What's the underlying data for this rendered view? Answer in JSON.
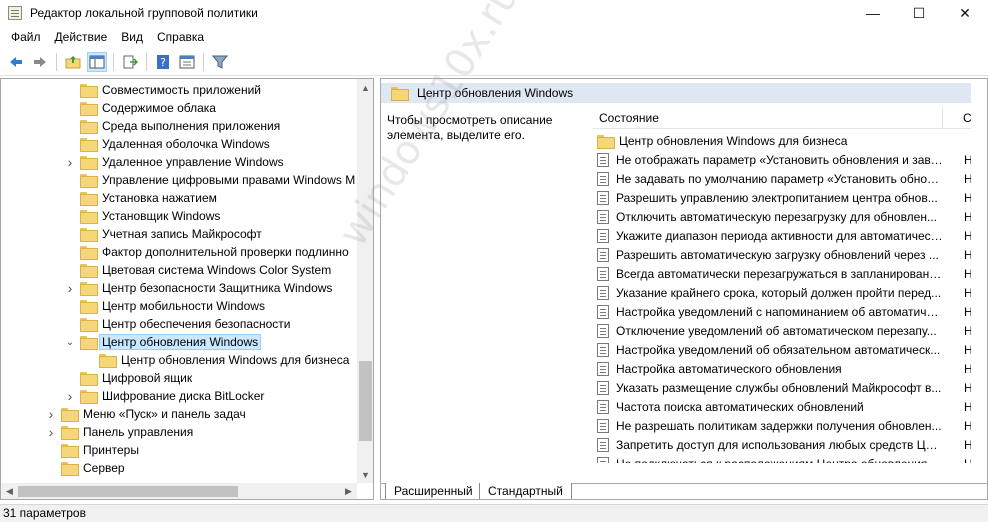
{
  "window": {
    "title": "Редактор локальной групповой политики",
    "icon": "gpedit-icon",
    "minimize_glyph": "—",
    "maximize_glyph": "☐",
    "close_glyph": "✕"
  },
  "menu": [
    "Файл",
    "Действие",
    "Вид",
    "Справка"
  ],
  "tree": {
    "items": [
      {
        "label": "Совместимость приложений",
        "level": 3,
        "expandable": false
      },
      {
        "label": "Содержимое облака",
        "level": 3,
        "expandable": false
      },
      {
        "label": "Среда выполнения приложения",
        "level": 3,
        "expandable": false
      },
      {
        "label": "Удаленная оболочка Windows",
        "level": 3,
        "expandable": false
      },
      {
        "label": "Удаленное управление Windows",
        "level": 3,
        "expandable": true
      },
      {
        "label": "Управление цифровыми правами Windows M",
        "level": 3,
        "expandable": false
      },
      {
        "label": "Установка нажатием",
        "level": 3,
        "expandable": false
      },
      {
        "label": "Установщик Windows",
        "level": 3,
        "expandable": false
      },
      {
        "label": "Учетная запись Майкрософт",
        "level": 3,
        "expandable": false
      },
      {
        "label": "Фактор дополнительной проверки подлинно",
        "level": 3,
        "expandable": false
      },
      {
        "label": "Цветовая система Windows Color System",
        "level": 3,
        "expandable": false
      },
      {
        "label": "Центр безопасности Защитника Windows",
        "level": 3,
        "expandable": true
      },
      {
        "label": "Центр мобильности Windows",
        "level": 3,
        "expandable": false
      },
      {
        "label": "Центр обеспечения безопасности",
        "level": 3,
        "expandable": false
      },
      {
        "label": "Центр обновления Windows",
        "level": 3,
        "expandable": true,
        "expanded": true,
        "selected": true
      },
      {
        "label": "Центр обновления Windows для бизнеса",
        "level": 4,
        "expandable": false
      },
      {
        "label": "Цифровой ящик",
        "level": 3,
        "expandable": false
      },
      {
        "label": "Шифрование диска BitLocker",
        "level": 3,
        "expandable": true
      },
      {
        "label": "Меню «Пуск» и панель задач",
        "level": 2,
        "expandable": true
      },
      {
        "label": "Панель управления",
        "level": 2,
        "expandable": true
      },
      {
        "label": "Принтеры",
        "level": 2,
        "expandable": false
      },
      {
        "label": "Сервер",
        "level": 2,
        "expandable": false
      }
    ]
  },
  "details": {
    "header": "Центр обновления Windows",
    "description": "Чтобы просмотреть описание элемента, выделите его.",
    "columns": [
      "Состояние",
      "С"
    ],
    "rows": [
      {
        "name": "Центр обновления Windows для бизнеса",
        "type": "folder",
        "state": ""
      },
      {
        "name": "Не отображать параметр «Установить обновления и заве...",
        "type": "policy",
        "state": "Н"
      },
      {
        "name": "Не задавать по умолчанию параметр «Установить обнов...",
        "type": "policy",
        "state": "Н"
      },
      {
        "name": "Разрешить управлению электропитанием центра обнов...",
        "type": "policy",
        "state": "Н"
      },
      {
        "name": "Отключить автоматическую перезагрузку для обновлен...",
        "type": "policy",
        "state": "Н"
      },
      {
        "name": "Укажите диапазон периода активности для автоматичеck...",
        "type": "policy",
        "state": "Н"
      },
      {
        "name": "Разрешить автоматическую загрузку обновлений через ...",
        "type": "policy",
        "state": "Н"
      },
      {
        "name": "Всегда автоматически перезагружаться в запланированн...",
        "type": "policy",
        "state": "Н"
      },
      {
        "name": "Указание крайнего срока, который должен пройти перед...",
        "type": "policy",
        "state": "Н"
      },
      {
        "name": "Настройка уведомлений с напоминанием об автоматиче...",
        "type": "policy",
        "state": "Н"
      },
      {
        "name": "Отключение уведомлений об автоматическом перезапу...",
        "type": "policy",
        "state": "Н"
      },
      {
        "name": "Настройка уведомлений об обязательном автоматическ...",
        "type": "policy",
        "state": "Н"
      },
      {
        "name": "Настройка автоматического обновления",
        "type": "policy",
        "state": "Н"
      },
      {
        "name": "Указать размещение службы обновлений Майкрософт в...",
        "type": "policy",
        "state": "Н"
      },
      {
        "name": "Частота поиска автоматических обновлений",
        "type": "policy",
        "state": "Н"
      },
      {
        "name": "Не разрешать политикам задержки получения обновлен...",
        "type": "policy",
        "state": "Н"
      },
      {
        "name": "Запретить доступ для использования любых средств Цен...",
        "type": "policy",
        "state": "Н"
      },
      {
        "name": "Не подключаться к расположениям Центра обновления ...",
        "type": "policy",
        "state": "Н"
      }
    ]
  },
  "tabs": [
    "Расширенный",
    "Стандартный"
  ],
  "status": "31 параметров",
  "watermark": "windows10x.ru"
}
